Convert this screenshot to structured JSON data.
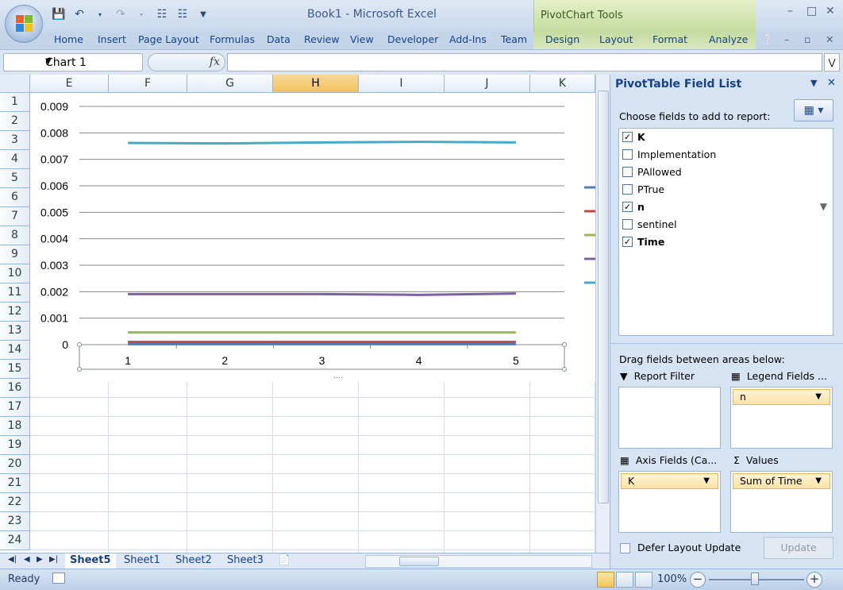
{
  "window": {
    "title": "Book1  -  Microsoft Excel",
    "context_tab_group": "PivotChart Tools",
    "quick_access": [
      "save-icon",
      "undo-icon",
      "redo-icon",
      "hierarchy-icon",
      "hierarchy-icon",
      "customize-icon"
    ]
  },
  "ribbon": {
    "tabs": [
      "Home",
      "Insert",
      "Page Layout",
      "Formulas",
      "Data",
      "Review",
      "View",
      "Developer",
      "Add-Ins",
      "Team"
    ],
    "context_tabs": [
      "Design",
      "Layout",
      "Format",
      "Analyze"
    ]
  },
  "formula_bar": {
    "name_box": "Chart 1",
    "fx": "fx",
    "value": ""
  },
  "sheet": {
    "columns": [
      "E",
      "F",
      "G",
      "H",
      "I",
      "J",
      "K"
    ],
    "selected_column": "H",
    "rows": [
      "1",
      "2",
      "3",
      "4",
      "5",
      "6",
      "7",
      "8",
      "9",
      "10",
      "11",
      "12",
      "13",
      "14",
      "15",
      "16",
      "17",
      "18",
      "19",
      "20",
      "21",
      "22",
      "23",
      "24"
    ]
  },
  "chart_data": {
    "type": "line",
    "x": [
      1,
      2,
      3,
      4,
      5
    ],
    "ylim": [
      0,
      0.009
    ],
    "yticks": [
      "0.009",
      "0.008",
      "0.007",
      "0.006",
      "0.005",
      "0.004",
      "0.003",
      "0.002",
      "0.001",
      "0"
    ],
    "grid": true,
    "legend": "right",
    "series": [
      {
        "color": "#4a7ebb",
        "values": [
          2e-05,
          2e-05,
          2e-05,
          2e-05,
          2e-05
        ]
      },
      {
        "color": "#be4b48",
        "values": [
          0.0001,
          0.0001,
          0.0001,
          0.0001,
          0.0001
        ]
      },
      {
        "color": "#98b954",
        "values": [
          0.00046,
          0.00046,
          0.00046,
          0.00046,
          0.00046
        ]
      },
      {
        "color": "#7d60a0",
        "values": [
          0.00191,
          0.00191,
          0.00191,
          0.00188,
          0.00193
        ]
      },
      {
        "color": "#46aac5",
        "values": [
          0.00762,
          0.0076,
          0.00764,
          0.00766,
          0.00764
        ]
      }
    ]
  },
  "sheet_tabs": [
    "Sheet5",
    "Sheet1",
    "Sheet2",
    "Sheet3"
  ],
  "active_sheet": "Sheet5",
  "field_list": {
    "title": "PivotTable Field List",
    "choose_label": "Choose fields to add to report:",
    "fields": [
      {
        "name": "K",
        "checked": true,
        "bold": true
      },
      {
        "name": "Implementation",
        "checked": false,
        "bold": false
      },
      {
        "name": "PAllowed",
        "checked": false,
        "bold": false
      },
      {
        "name": "PTrue",
        "checked": false,
        "bold": false
      },
      {
        "name": "n",
        "checked": true,
        "bold": true,
        "filtered": true
      },
      {
        "name": "sentinel",
        "checked": false,
        "bold": false
      },
      {
        "name": "Time",
        "checked": true,
        "bold": true
      }
    ],
    "drag_label": "Drag fields between areas below:",
    "areas": {
      "report_filter": {
        "label": "Report Filter",
        "items": []
      },
      "legend_fields": {
        "label": "Legend Fields ...",
        "items": [
          "n"
        ]
      },
      "axis_fields": {
        "label": "Axis Fields (Ca...",
        "items": [
          "K"
        ]
      },
      "values": {
        "label": "Values",
        "items": [
          "Sum of Time"
        ]
      }
    },
    "defer_label": "Defer Layout Update",
    "update_button": "Update"
  },
  "status": {
    "text": "Ready",
    "zoom": "100%"
  }
}
